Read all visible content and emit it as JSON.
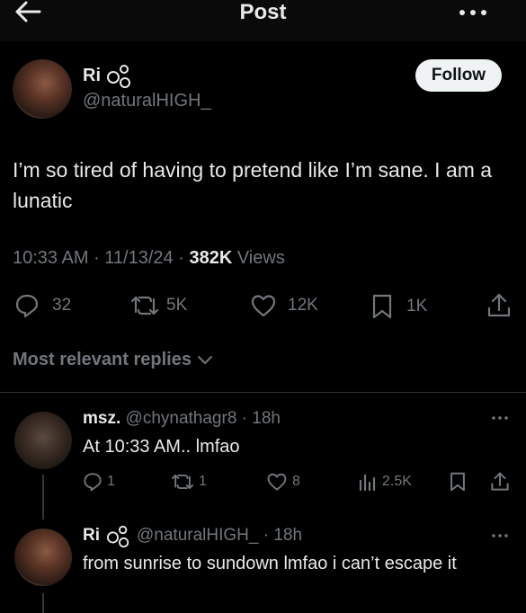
{
  "header": {
    "title": "Post"
  },
  "post": {
    "author_name": "Ri",
    "author_handle": "@naturalHIGH_",
    "follow_label": "Follow",
    "text": "I’m so tired of having to pretend like I’m sane. I am a lunatic",
    "time": "10:33 AM",
    "date": "11/13/24",
    "views_count": "382K",
    "views_label": "Views",
    "actions": {
      "replies": "32",
      "reposts": "5K",
      "likes": "12K",
      "bookmarks": "1K"
    }
  },
  "replies_filter": {
    "label": "Most relevant replies"
  },
  "replies": [
    {
      "name": "msz.",
      "handle": "@chynathagr8",
      "age": "18h",
      "text": "At 10:33 AM.. lmfao",
      "actions": {
        "replies": "1",
        "reposts": "1",
        "likes": "8",
        "views": "2.5K"
      }
    },
    {
      "name": "Ri",
      "handle": "@naturalHIGH_",
      "age": "18h",
      "text": "from sunrise to sundown lmfao i can’t escape it"
    }
  ],
  "colors": {
    "background": "#000000",
    "text": "#e7e9ea",
    "muted": "#71767b",
    "follow_bg": "#eff3f4"
  },
  "icons": [
    "back-arrow-icon",
    "more-icon",
    "reply-icon",
    "repost-icon",
    "like-icon",
    "bookmark-icon",
    "share-icon",
    "views-icon",
    "chevron-down-icon",
    "emoji-icon"
  ]
}
